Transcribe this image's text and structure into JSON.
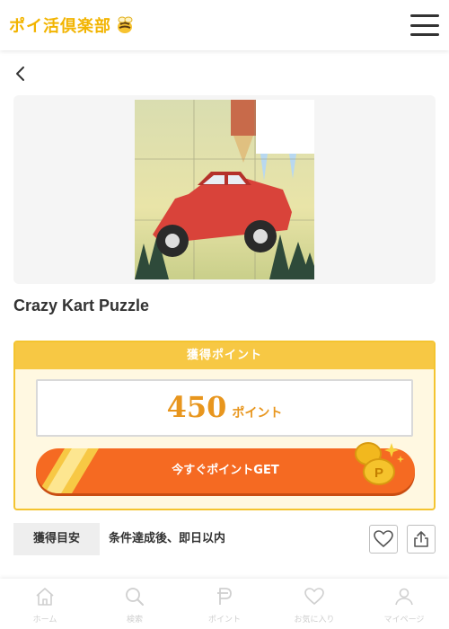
{
  "header": {
    "logo_text": "ポイ活倶楽部",
    "logo_icon": "bee-icon",
    "menu_icon": "hamburger-menu-icon"
  },
  "nav": {
    "back_icon": "chevron-left-icon"
  },
  "game": {
    "title": "Crazy Kart Puzzle",
    "thumbnail": "red-car-puzzle-image"
  },
  "points": {
    "header_label": "獲得ポイント",
    "value": "450",
    "unit": "ポイント",
    "cta_label": "今すぐポイントGET",
    "cta_decoration": "coins-icon"
  },
  "estimate": {
    "label": "獲得目安",
    "value": "条件達成後、即日以内"
  },
  "actions": {
    "favorite_icon": "heart-icon",
    "share_icon": "share-icon"
  },
  "tabs": [
    {
      "label": "ホーム",
      "icon": "home-icon"
    },
    {
      "label": "検索",
      "icon": "search-icon"
    },
    {
      "label": "ポイント",
      "icon": "point-icon"
    },
    {
      "label": "お気に入り",
      "icon": "heart-icon"
    },
    {
      "label": "マイページ",
      "icon": "user-icon"
    }
  ],
  "colors": {
    "accent_yellow": "#f7c844",
    "accent_orange": "#f56a22",
    "points_text": "#e8961e",
    "tab_inactive": "#cfcfcf"
  }
}
